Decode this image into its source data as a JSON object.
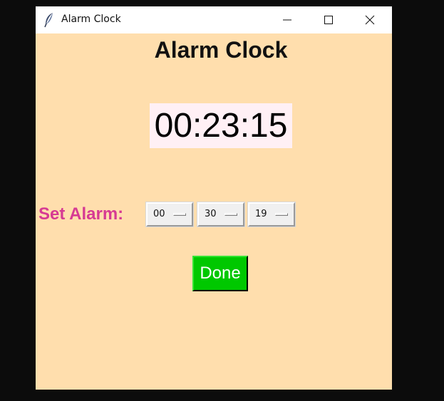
{
  "window": {
    "title": "Alarm Clock",
    "icon": "feather-icon"
  },
  "app": {
    "heading": "Alarm Clock",
    "current_time": "00:23:15",
    "set_alarm_label": "Set Alarm:",
    "alarm": {
      "hour": "00",
      "minute": "30",
      "second": "19"
    },
    "done_label": "Done"
  },
  "colors": {
    "background": "#ffdead",
    "clock_background": "#fff0f5",
    "label_color": "#d63a93",
    "done_button": "#00c800"
  }
}
